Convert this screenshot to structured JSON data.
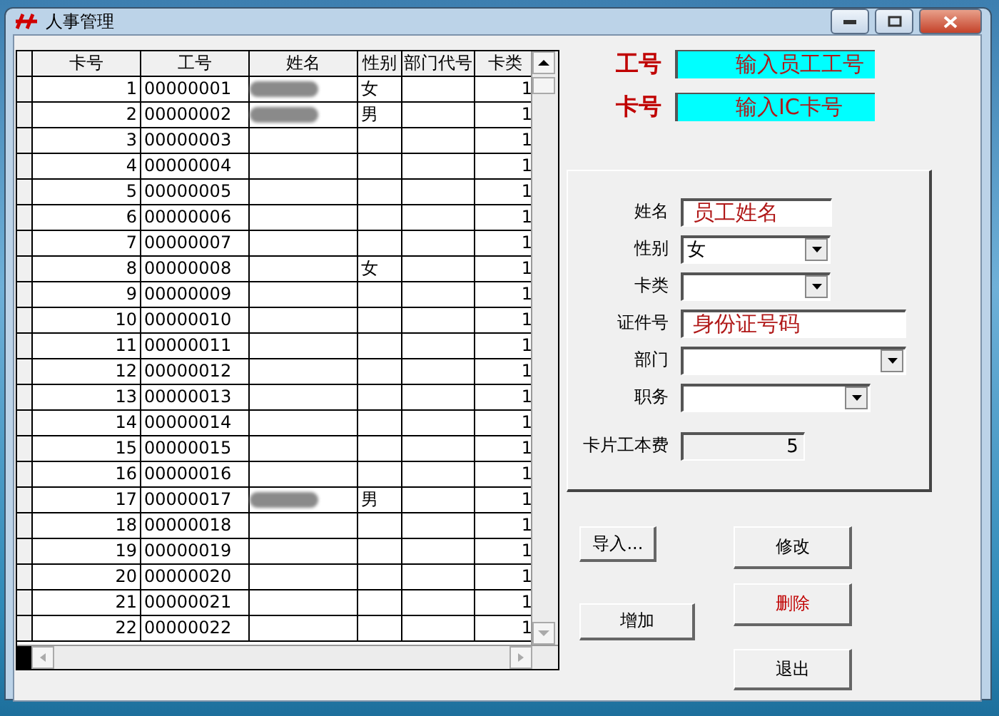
{
  "window": {
    "title": "人事管理"
  },
  "table": {
    "columns": [
      "卡号",
      "工号",
      "姓名",
      "性别",
      "部门代号",
      "卡类"
    ],
    "rows": [
      {
        "card_no": "1",
        "emp_no": "00000001",
        "name_redacted": true,
        "gender": "女",
        "card_type": "1"
      },
      {
        "card_no": "2",
        "emp_no": "00000002",
        "name_redacted": true,
        "gender": "男",
        "card_type": "1"
      },
      {
        "card_no": "3",
        "emp_no": "00000003",
        "name_redacted": false,
        "card_type": "1"
      },
      {
        "card_no": "4",
        "emp_no": "00000004",
        "name_redacted": false,
        "card_type": "1"
      },
      {
        "card_no": "5",
        "emp_no": "00000005",
        "name_redacted": false,
        "card_type": "1"
      },
      {
        "card_no": "6",
        "emp_no": "00000006",
        "name_redacted": false,
        "card_type": "1"
      },
      {
        "card_no": "7",
        "emp_no": "00000007",
        "name_redacted": false,
        "card_type": "1"
      },
      {
        "card_no": "8",
        "emp_no": "00000008",
        "name_redacted": false,
        "gender": "女",
        "card_type": "1"
      },
      {
        "card_no": "9",
        "emp_no": "00000009",
        "name_redacted": false,
        "card_type": "1"
      },
      {
        "card_no": "10",
        "emp_no": "00000010",
        "name_redacted": false,
        "card_type": "1"
      },
      {
        "card_no": "11",
        "emp_no": "00000011",
        "name_redacted": false,
        "card_type": "1"
      },
      {
        "card_no": "12",
        "emp_no": "00000012",
        "name_redacted": false,
        "card_type": "1"
      },
      {
        "card_no": "13",
        "emp_no": "00000013",
        "name_redacted": false,
        "card_type": "1"
      },
      {
        "card_no": "14",
        "emp_no": "00000014",
        "name_redacted": false,
        "card_type": "1"
      },
      {
        "card_no": "15",
        "emp_no": "00000015",
        "name_redacted": false,
        "card_type": "1"
      },
      {
        "card_no": "16",
        "emp_no": "00000016",
        "name_redacted": false,
        "card_type": "1"
      },
      {
        "card_no": "17",
        "emp_no": "00000017",
        "name_redacted": true,
        "gender": "男",
        "card_type": "1"
      },
      {
        "card_no": "18",
        "emp_no": "00000018",
        "name_redacted": false,
        "card_type": "1"
      },
      {
        "card_no": "19",
        "emp_no": "00000019",
        "name_redacted": false,
        "card_type": "1"
      },
      {
        "card_no": "20",
        "emp_no": "00000020",
        "name_redacted": false,
        "card_type": "1"
      },
      {
        "card_no": "21",
        "emp_no": "00000021",
        "name_redacted": false,
        "card_type": "1"
      },
      {
        "card_no": "22",
        "emp_no": "00000022",
        "name_redacted": false,
        "card_type": "1"
      }
    ]
  },
  "lookup": [
    {
      "label": "工号",
      "value": "输入员工工号"
    },
    {
      "label": "卡号",
      "value": "输入IC卡号"
    }
  ],
  "form": {
    "fields": [
      {
        "kind": "text",
        "label": "姓名",
        "value": "员工姓名"
      },
      {
        "kind": "select",
        "label": "性别",
        "value": "女"
      },
      {
        "kind": "select",
        "label": "卡类"
      },
      {
        "kind": "text",
        "label": "证件号",
        "value": "身份证号码"
      },
      {
        "kind": "select",
        "label": "部门"
      },
      {
        "kind": "select",
        "label": "职务"
      },
      {
        "kind": "readonly",
        "label": "卡片工本费",
        "value": "5"
      }
    ]
  },
  "buttons": [
    {
      "label": "导入...",
      "danger": false
    },
    {
      "label": "修改",
      "danger": false
    },
    {
      "label": "增加",
      "danger": false
    },
    {
      "label": "删除",
      "danger": true
    },
    {
      "label": "退出",
      "danger": false
    }
  ]
}
